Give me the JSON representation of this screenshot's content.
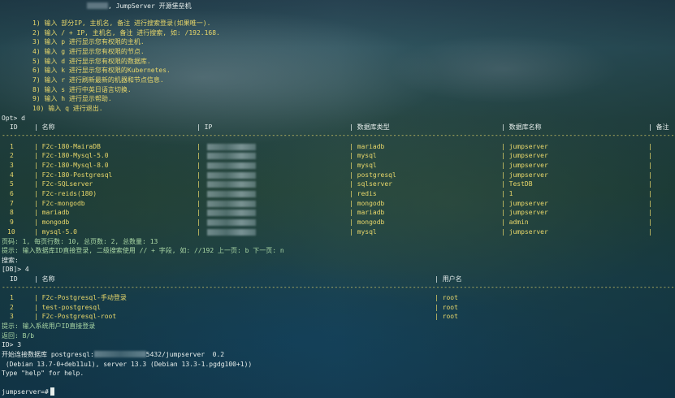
{
  "banner": {
    "title_suffix": ", JumpServer 开源堡垒机",
    "menu": [
      "1) 输入 部分IP, 主机名, 备注 进行搜索登录(如果唯一).",
      "2) 输入 / + IP, 主机名, 备注 进行搜索, 如: /192.168.",
      "3) 输入 p 进行显示您有权限的主机.",
      "4) 输入 g 进行显示您有权限的节点.",
      "5) 输入 d 进行显示您有权限的数据库.",
      "6) 输入 k 进行显示您有权限的Kubernetes.",
      "7) 输入 r 进行刷新最新的机器和节点信息.",
      "8) 输入 s 进行中英日语言切换.",
      "9) 输入 h 进行显示帮助.",
      "10) 输入 q 进行退出."
    ]
  },
  "prompt1": "Opt> d",
  "db_table": {
    "headers": [
      "ID",
      "| 名称",
      "| IP",
      "| 数据库类型",
      "| 数据库名称",
      "| 备注"
    ],
    "rows": [
      {
        "id": "1",
        "name": "| F2c-180-MairaDB",
        "ip": "|",
        "type": "| mariadb",
        "dbname": "| jumpserver",
        "note": "|"
      },
      {
        "id": "2",
        "name": "| F2c-180-Mysql-5.0",
        "ip": "|",
        "type": "| mysql",
        "dbname": "| jumpserver",
        "note": "|"
      },
      {
        "id": "3",
        "name": "| F2c-180-Mysql-8.0",
        "ip": "|",
        "type": "| mysql",
        "dbname": "| jumpserver",
        "note": "|"
      },
      {
        "id": "4",
        "name": "| F2c-180-Postgresql",
        "ip": "|",
        "type": "| postgresql",
        "dbname": "| jumpserver",
        "note": "|"
      },
      {
        "id": "5",
        "name": "| F2c-SQLserver",
        "ip": "|",
        "type": "| sqlserver",
        "dbname": "| TestDB",
        "note": "|"
      },
      {
        "id": "6",
        "name": "| F2c-reids(180)",
        "ip": "|",
        "type": "| redis",
        "dbname": "| 1",
        "note": "|"
      },
      {
        "id": "7",
        "name": "| F2c-mongodb",
        "ip": "|",
        "type": "| mongodb",
        "dbname": "| jumpserver",
        "note": "|"
      },
      {
        "id": "8",
        "name": "| mariadb",
        "ip": "|",
        "type": "| mariadb",
        "dbname": "| jumpserver",
        "note": "|"
      },
      {
        "id": "9",
        "name": "| mongodb",
        "ip": "|",
        "type": "| mongodb",
        "dbname": "| admin",
        "note": "|"
      },
      {
        "id": "10",
        "name": "| mysql-5.0",
        "ip": "|",
        "type": "| mysql",
        "dbname": "| jumpserver",
        "note": "|"
      }
    ]
  },
  "pagination": "页码: 1, 每页行数: 10, 总页数: 2, 总数量: 13",
  "hint1": "提示: 输入数据库ID直接登录, 二级搜索使用 // + 字段, 如: //192 上一页: b 下一页: n",
  "search": "搜索:",
  "prompt2": "[DB]> 4",
  "user_table": {
    "headers": [
      "ID",
      "| 名称",
      "| 用户名"
    ],
    "rows": [
      {
        "id": "1",
        "name": "| F2c-Postgresql-手动登录",
        "user": "| root"
      },
      {
        "id": "2",
        "name": "| test-postgresql",
        "user": "| root"
      },
      {
        "id": "3",
        "name": "| F2c-Postgresql-root",
        "user": "| root"
      }
    ]
  },
  "hint2": "提示: 输入系统用户ID直接登录",
  "back": "返回: B/b",
  "prompt3": "ID> 3",
  "connect_prefix": "开始连接数据库 postgresql:",
  "connect_suffix": "5432/jumpserver  0.2",
  "psql_version": " (Debian 13.7-0+deb11u1), server 13.3 (Debian 13.3-1.pgdg100+1))",
  "psql_help": "Type \"help\" for help.",
  "final_prompt": "jumpserver=#",
  "dash_line": "-------------------------------------------------------------------------------------------------------------------------------------------------------------------------------------------------------------------"
}
